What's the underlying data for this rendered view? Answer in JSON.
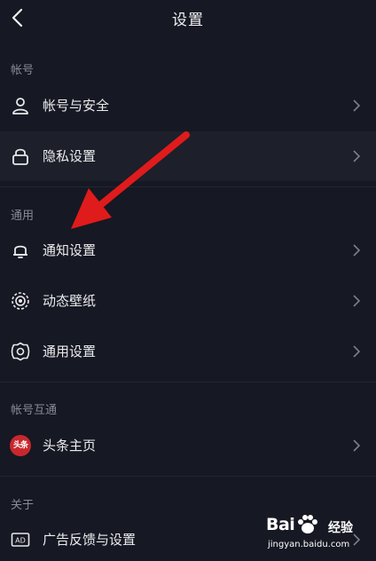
{
  "header": {
    "title": "设置"
  },
  "sections": {
    "account": {
      "label": "帐号",
      "items": [
        {
          "label": "帐号与安全",
          "icon": "user-icon"
        },
        {
          "label": "隐私设置",
          "icon": "lock-icon"
        }
      ]
    },
    "general": {
      "label": "通用",
      "items": [
        {
          "label": "通知设置",
          "icon": "bell-icon"
        },
        {
          "label": "动态壁纸",
          "icon": "wallpaper-icon"
        },
        {
          "label": "通用设置",
          "icon": "gear-icon"
        }
      ]
    },
    "interop": {
      "label": "帐号互通",
      "items": [
        {
          "label": "头条主页",
          "icon": "toutiao-logo-icon",
          "logo_text": "头条"
        }
      ]
    },
    "about": {
      "label": "关于",
      "items": [
        {
          "label": "广告反馈与设置",
          "icon": "ad-icon"
        }
      ]
    }
  },
  "watermark": {
    "brand": "Bai",
    "brand_suffix": "经验",
    "url": "jingyan.baidu.com"
  },
  "colors": {
    "background": "#161823",
    "highlight_row": "#1d1f2a",
    "section_label": "#8a8b93",
    "annotation_arrow": "#e01b1b",
    "toutiao_red": "#c8282d"
  }
}
